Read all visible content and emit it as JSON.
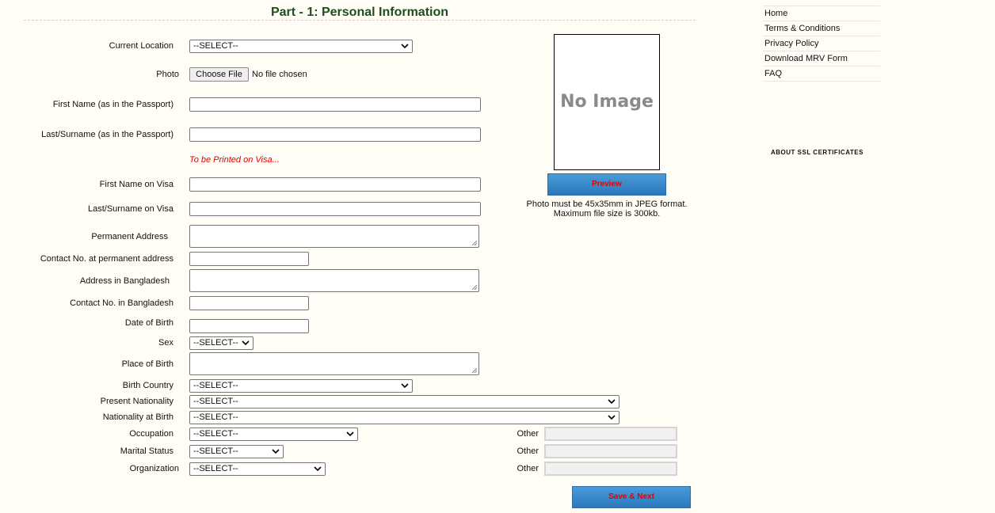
{
  "form": {
    "title": "Part - 1: Personal Information",
    "current_location": {
      "label": "Current Location",
      "value": "--SELECT--"
    },
    "photo": {
      "label": "Photo",
      "button": "Choose File",
      "status": "No file chosen"
    },
    "first_name_passport": {
      "label": "First Name (as in the Passport)",
      "value": ""
    },
    "last_name_passport": {
      "label": "Last/Surname (as in the Passport)",
      "value": ""
    },
    "visa_note": "To be Printed on Visa...",
    "first_name_visa": {
      "label": "First Name on Visa",
      "value": ""
    },
    "last_name_visa": {
      "label": "Last/Surname on Visa",
      "value": ""
    },
    "permanent_address": {
      "label": "Permanent Address"
    },
    "contact_permanent": {
      "label": "Contact No. at permanent address"
    },
    "address_bangladesh": {
      "label": "Address in Bangladesh"
    },
    "contact_bangladesh": {
      "label": "Contact No. in Bangladesh"
    },
    "date_of_birth": {
      "label": "Date of Birth"
    },
    "sex": {
      "label": "Sex",
      "value": "--SELECT--"
    },
    "place_of_birth": {
      "label": "Place of Birth"
    },
    "birth_country": {
      "label": "Birth Country",
      "value": "--SELECT--"
    },
    "present_nationality": {
      "label": "Present Nationality",
      "value": "--SELECT--"
    },
    "nationality_at_birth": {
      "label": "Nationality at Birth",
      "value": "--SELECT--"
    },
    "occupation": {
      "label": "Occupation",
      "value": "--SELECT--",
      "other_label": "Other"
    },
    "marital_status": {
      "label": "Marital Status",
      "value": "--SELECT--",
      "other_label": "Other"
    },
    "organization": {
      "label": "Organization",
      "value": "--SELECT--",
      "other_label": "Other"
    },
    "save_button": "Save & Next"
  },
  "photo_panel": {
    "placeholder": "No Image",
    "preview_button": "Preview",
    "note_line1": "Photo must be 45x35mm in JPEG format.",
    "note_line2": "Maximum file size is 300kb."
  },
  "sidebar": {
    "links": [
      "Home",
      "Terms & Conditions",
      "Privacy Policy",
      "Download MRV Form",
      "FAQ"
    ],
    "ssl_text": "ABOUT SSL CERTIFICATES"
  },
  "colors": {
    "background": "#fffdf5",
    "title": "#1e4d1e",
    "accent_red": "#e60000",
    "button_blue": "#2a78be"
  }
}
